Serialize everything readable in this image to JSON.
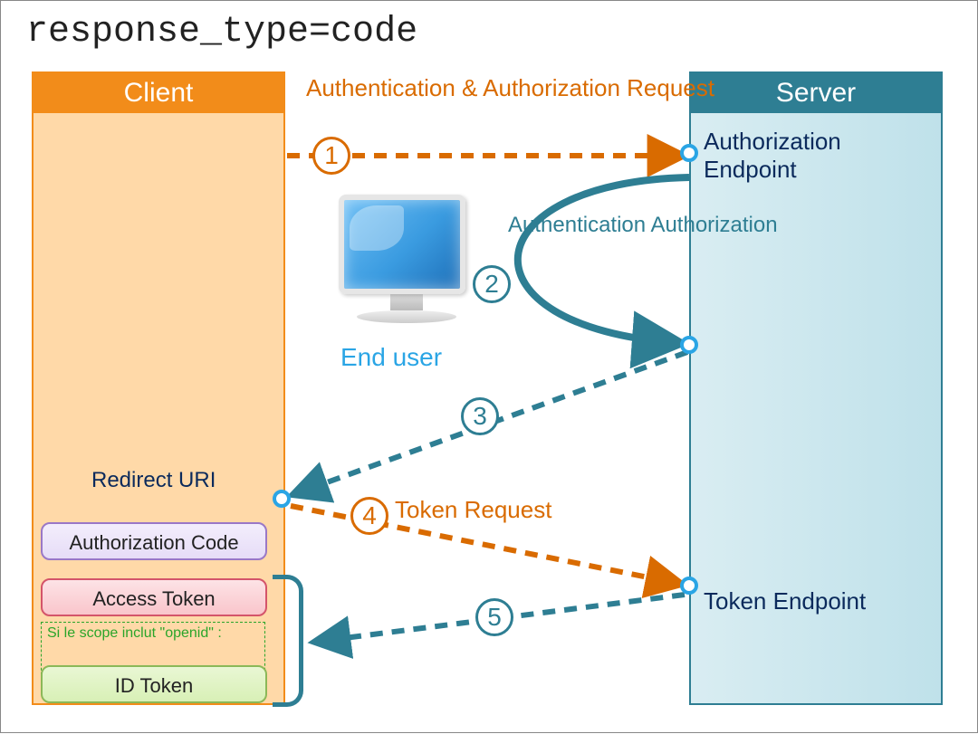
{
  "title": "response_type=code",
  "client": {
    "header": "Client",
    "redirect_label": "Redirect URI",
    "authcode": "Authorization Code",
    "access": "Access Token",
    "idtoken": "ID Token",
    "scope_note": "Si le scope inclut \"openid\" :"
  },
  "server": {
    "header": "Server",
    "auth_endpoint": "Authorization Endpoint",
    "token_endpoint": "Token Endpoint"
  },
  "flows": {
    "step1_label": "Authentication & Authorization Request",
    "step2_label": "Authentication Authorization",
    "step4_label": "Token Request",
    "end_user": "End user"
  },
  "steps": {
    "s1": "1",
    "s2": "2",
    "s3": "3",
    "s4": "4",
    "s5": "5"
  },
  "colors": {
    "orange": "#d96b00",
    "teal": "#2e7e93",
    "lightblue": "#2aa5e5"
  }
}
